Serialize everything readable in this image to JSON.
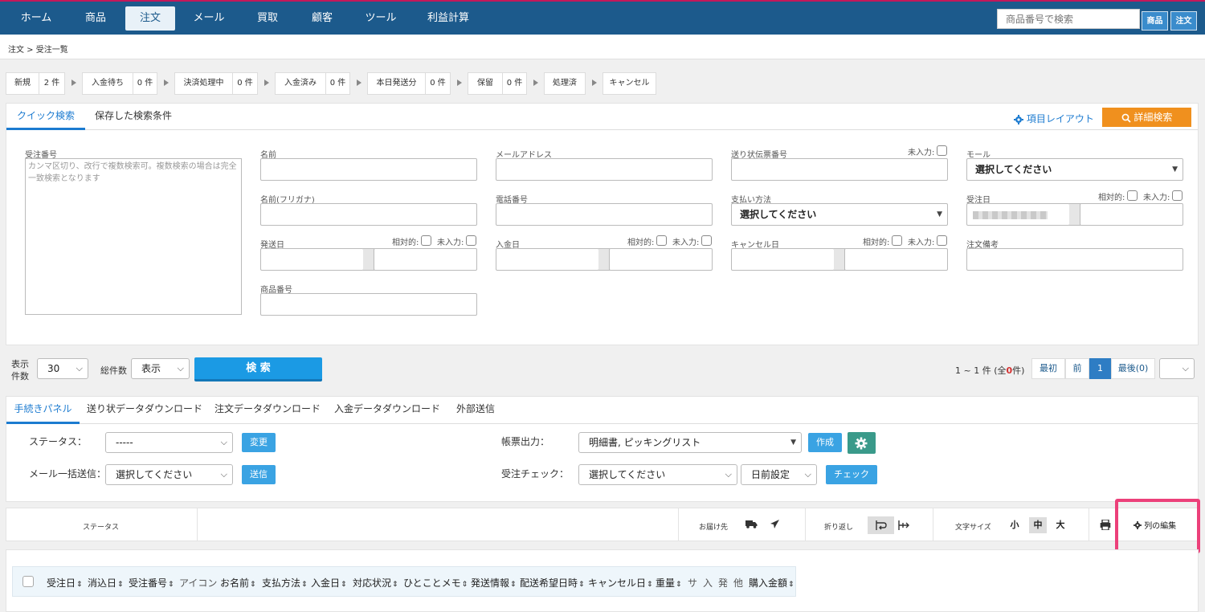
{
  "nav": {
    "items": [
      "ホーム",
      "商品",
      "注文",
      "メール",
      "買取",
      "顧客",
      "ツール",
      "利益計算"
    ],
    "active_index": 2,
    "search_placeholder": "商品番号で検索",
    "btn_product": "商品",
    "btn_order": "注文"
  },
  "breadcrumb": "注文 > 受注一覧",
  "steps": [
    {
      "label": "新規",
      "count": "2 件"
    },
    {
      "label": "入金待ち",
      "count": "0 件"
    },
    {
      "label": "決済処理中",
      "count": "0 件"
    },
    {
      "label": "入金済み",
      "count": "0 件"
    },
    {
      "label": "本日発送分",
      "count": "0 件"
    },
    {
      "label": "保留",
      "count": "0 件"
    },
    {
      "label": "処理済",
      "count": ""
    },
    {
      "label": "キャンセル",
      "count": ""
    }
  ],
  "search_panel": {
    "tabs": [
      "クイック検索",
      "保存した検索条件"
    ],
    "layout_link": "項目レイアウト",
    "detail_button": "詳細検索",
    "order_number_label": "受注番号",
    "order_number_placeholder": "カンマ区切り、改行で複数検索可。複数検索の場合は完全一致検索となります",
    "name_label": "名前",
    "name_kana_label": "名前(フリガナ)",
    "ship_date_label": "発送日",
    "product_number_label": "商品番号",
    "email_label": "メールアドレス",
    "phone_label": "電話番号",
    "payment_date_label": "入金日",
    "tracking_label": "送り状伝票番号",
    "payment_method_label": "支払い方法",
    "payment_method_value": "選択してください",
    "cancel_date_label": "キャンセル日",
    "mall_label": "モール",
    "mall_value": "選択してください",
    "order_date_label": "受注日",
    "order_note_label": "注文備考",
    "relative_label": "相対的:",
    "empty_label": "未入力:"
  },
  "controls": {
    "display_label": "表示\n件数",
    "display_value": "30",
    "total_label": "総件数",
    "total_value": "表示",
    "search_button": "検 索",
    "result_prefix": "1 ~ 1 件 (全",
    "result_count": "0",
    "result_suffix": "件)",
    "pager": [
      "最初",
      "前",
      "1",
      "最後(0)"
    ]
  },
  "procedure_panel": {
    "tabs": [
      "手続きパネル",
      "送り状データダウンロード",
      "注文データダウンロード",
      "入金データダウンロード",
      "外部送信"
    ],
    "status_label": "ステータス：",
    "status_value": "-----",
    "change_button": "変更",
    "mail_label": "メール一括送信：",
    "mail_value": "選択してください",
    "send_button": "送信",
    "form_label": "帳票出力：",
    "form_value": "明細書, ピッキングリスト",
    "create_button": "作成",
    "check_label": "受注チェック：",
    "check_value": "選択してください",
    "days_value": "日前設定",
    "check_button": "チェック"
  },
  "toolbar": {
    "status_label": "ステータス",
    "delivery_label": "お届け先",
    "wrap_label": "折り返し",
    "font_size_label": "文字サイズ",
    "sizes": [
      "小",
      "中",
      "大"
    ],
    "edit_columns": "列の編集"
  },
  "columns": [
    {
      "label": "受注日",
      "sortable": true
    },
    {
      "label": "消込日",
      "sortable": true
    },
    {
      "label": "受注番号",
      "sortable": true
    },
    {
      "label": "アイコン",
      "sortable": false
    },
    {
      "label": "お名前",
      "sortable": true
    },
    {
      "label": "支払方法",
      "sortable": true
    },
    {
      "label": "入金日",
      "sortable": true
    },
    {
      "label": "対応状況",
      "sortable": true
    },
    {
      "label": "ひとことメモ",
      "sortable": true
    },
    {
      "label": "発送情報",
      "sortable": true
    },
    {
      "label": "配送希望日時",
      "sortable": true
    },
    {
      "label": "キャンセル日",
      "sortable": true
    },
    {
      "label": "重量",
      "sortable": true
    },
    {
      "label": "サ",
      "sortable": false
    },
    {
      "label": "入",
      "sortable": false
    },
    {
      "label": "発",
      "sortable": false
    },
    {
      "label": "他",
      "sortable": false
    },
    {
      "label": "購入金額",
      "sortable": true
    }
  ],
  "colors": {
    "nav": "#1c5a8c",
    "accent": "#1c7bd0",
    "orange": "#f0901e",
    "highlight": "#ec407a",
    "teal": "#3a9a8a"
  }
}
